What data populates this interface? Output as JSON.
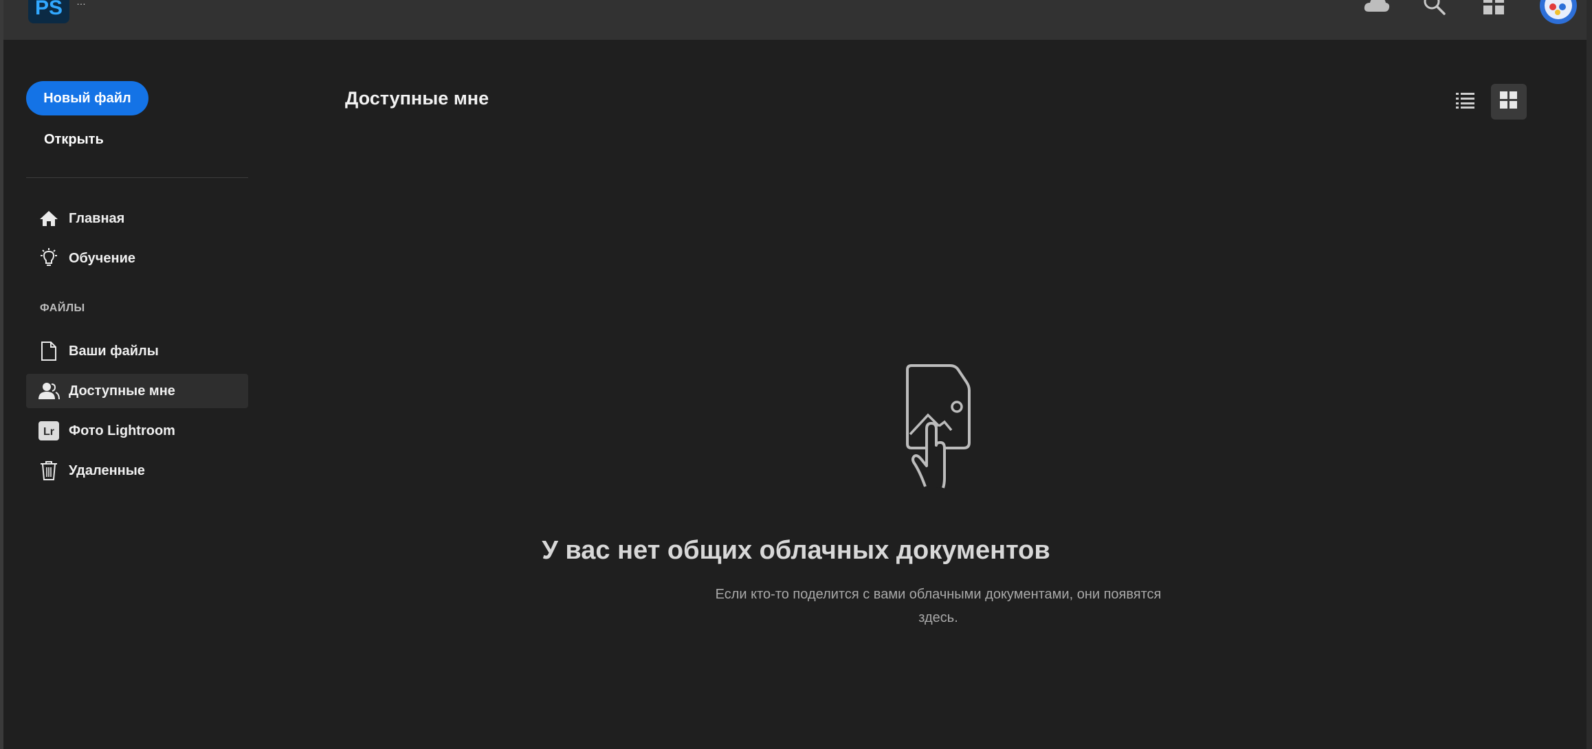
{
  "app": {
    "logo_text": "PS",
    "document_title": "…"
  },
  "topbar": {
    "icons": [
      "cloud-icon",
      "search-icon",
      "apps-icon",
      "avatar"
    ]
  },
  "sidebar": {
    "new_file_label": "Новый файл",
    "open_label": "Открыть",
    "nav": [
      {
        "label": "Главная",
        "icon": "home-icon"
      },
      {
        "label": "Обучение",
        "icon": "lightbulb-icon"
      }
    ],
    "files_section_label": "ФАЙЛЫ",
    "files": [
      {
        "label": "Ваши файлы",
        "icon": "document-icon"
      },
      {
        "label": "Доступные мне",
        "icon": "shared-user-icon",
        "active": true
      },
      {
        "label": "Фото Lightroom",
        "icon": "lightroom-icon"
      },
      {
        "label": "Удаленные",
        "icon": "trash-icon"
      }
    ]
  },
  "main": {
    "title": "Доступные мне",
    "view_modes": [
      "list",
      "grid"
    ],
    "active_view": "grid",
    "empty_state": {
      "title": "У вас нет общих облачных документов",
      "description": "Если кто-то поделится с вами облачными документами, они появятся здесь."
    }
  },
  "colors": {
    "background": "#1f1f1f",
    "topbar": "#323232",
    "accent": "#1473e6",
    "active_item": "#2e2e2e"
  }
}
